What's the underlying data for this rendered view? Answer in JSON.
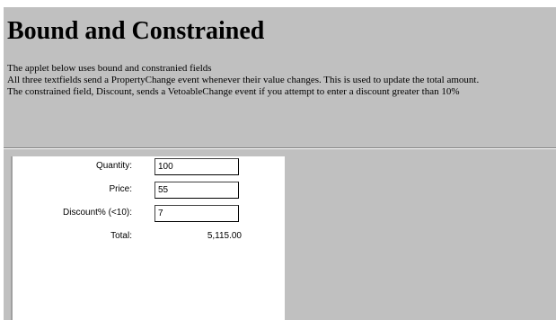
{
  "page": {
    "title": "Bound and Constrained",
    "description_lines": [
      "The applet below uses bound and constranied fields",
      "All three textfields send a PropertyChange event whenever their value changes. This is used to update the total amount.",
      "The constrained field, Discount, sends a VetoableChange event if you attempt to enter a discount greater than 10%"
    ]
  },
  "applet": {
    "quantity": {
      "label": "Quantity:",
      "value": "100"
    },
    "price": {
      "label": "Price:",
      "value": "55"
    },
    "discount": {
      "label": "Discount% (<10):",
      "value": "7"
    },
    "total": {
      "label": "Total:",
      "value": "5,115.00"
    }
  },
  "colors": {
    "page_background": "#c0c0c0",
    "applet_background": "#ffffff"
  }
}
